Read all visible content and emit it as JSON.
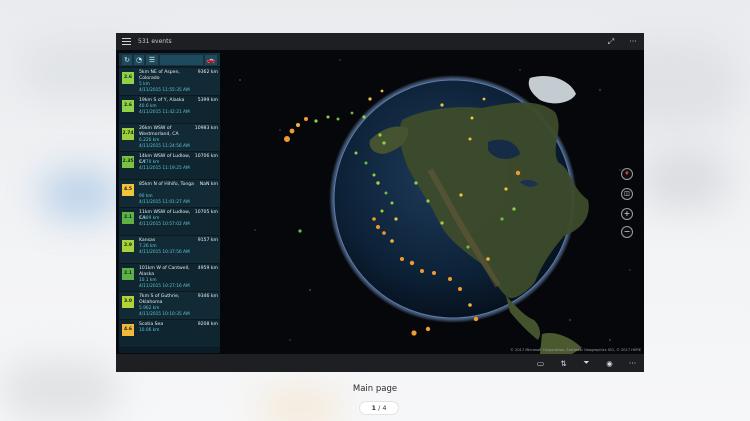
{
  "window": {
    "title": "531 events",
    "menu_icon": "hamburger-icon",
    "fullscreen_icon": "expand-icon",
    "more_icon": "ellipsis-icon"
  },
  "sidebar": {
    "toolbar": {
      "refresh_icon": "refresh-icon",
      "clock_icon": "clock-icon",
      "list_icon": "list-icon",
      "car_icon": "car-icon"
    },
    "events": [
      {
        "mag": "2.6",
        "place": "5km NE of Aspen, Colorado",
        "dist": "9362 km",
        "depth": "5 km",
        "time": "4/11/2015 11:55:35 AM",
        "color": "#8fd24a"
      },
      {
        "mag": "2.6",
        "place": "19km S of Y, Alaska",
        "dist": "5399 km",
        "depth": "40.6 km",
        "time": "4/11/2015 11:42:21 AM",
        "color": "#8fd24a"
      },
      {
        "mag": "2.74",
        "place": "26km WSW of Westmorland, CA",
        "dist": "10983 km",
        "depth": "6.220 km",
        "time": "4/11/2015 11:24:56 AM",
        "color": "#9ccf3b"
      },
      {
        "mag": "2.35",
        "place": "14km WSW of Ludlow, CA",
        "dist": "10706 km",
        "depth": "7.770 km",
        "time": "4/11/2015 11:19:25 AM",
        "color": "#7bc243"
      },
      {
        "mag": "4.5",
        "place": "85km N of Hihifo, Tonga",
        "dist": "NaN km",
        "depth": "90 km",
        "time": "4/11/2015 11:01:27 AM",
        "color": "#f3c43b"
      },
      {
        "mag": "2.1",
        "place": "11km WSW of Ludlow, CA",
        "dist": "10705 km",
        "depth": "1.389 km",
        "time": "4/11/2015 10:57:02 AM",
        "color": "#5db246"
      },
      {
        "mag": "2.9",
        "place": "Kansas",
        "dist": "9157 km",
        "depth": "7.26 km",
        "time": "4/11/2015 10:37:56 AM",
        "color": "#a7d23a"
      },
      {
        "mag": "2.1",
        "place": "101km W of Cantwell, Alaska",
        "dist": "4959 km",
        "depth": "10.1 km",
        "time": "4/11/2015 10:27:16 AM",
        "color": "#5db246"
      },
      {
        "mag": "3.0",
        "place": "7km S of Guthrie, Oklahoma",
        "dist": "9346 km",
        "depth": "5.962 km",
        "time": "4/11/2015 10:10:35 AM",
        "color": "#b3d438"
      },
      {
        "mag": "4.6",
        "place": "Scotia Sea",
        "dist": "9208 km",
        "depth": "10.06 km",
        "time": "",
        "color": "#f3b73a"
      }
    ]
  },
  "map": {
    "copyright": "© 2017 Microsoft Corporation, Earthstar Geographics SIO, © 2017 HERE",
    "controls": {
      "compass": "compass-icon",
      "tilt": "tilt-icon",
      "zoom_in": "+",
      "zoom_out": "−"
    }
  },
  "bottombar": {
    "icons": [
      "map-view-icon",
      "sort-icon",
      "filter-icon",
      "location-icon",
      "ellipsis-icon"
    ]
  },
  "caption": "Main page",
  "pager": {
    "current": "1",
    "total": "4",
    "sep": " / "
  }
}
